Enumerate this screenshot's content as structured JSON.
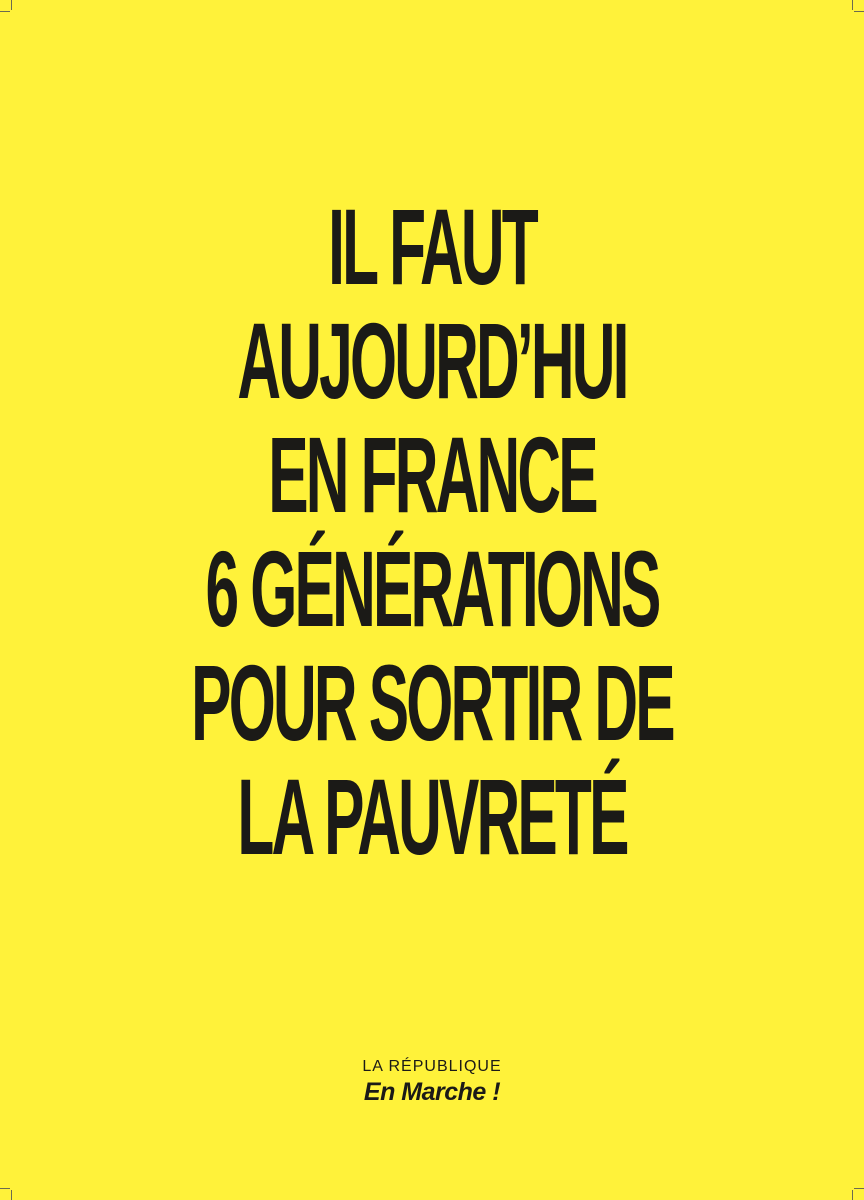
{
  "poster": {
    "background_color": "#fff23a",
    "text_color": "#1b1a17",
    "headline_lines": [
      "IL FAUT",
      "AUJOURD’HUI",
      "EN FRANCE",
      "6 GÉNÉRATIONS",
      "POUR SORTIR DE",
      "LA PAUVRETÉ"
    ],
    "brand": {
      "line1": "LA RÉPUBLIQUE",
      "line2": "En Marche !"
    }
  }
}
